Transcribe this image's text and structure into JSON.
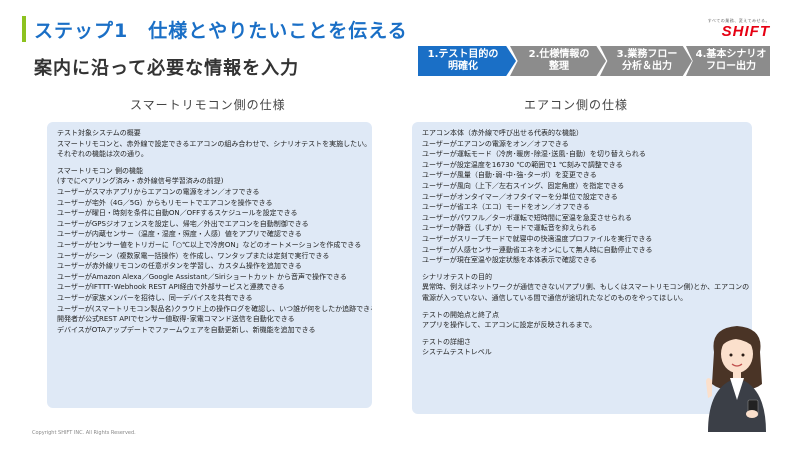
{
  "header": {
    "title": "ステップ1　仕様とやりたいことを伝える",
    "subtitle": "案内に沿って必要な情報を入力"
  },
  "logo": {
    "tagline": "すべての業務、変えてみせる。",
    "word": "SHIFT"
  },
  "steps": [
    {
      "label": "1.テスト目的の\n明確化",
      "active": true
    },
    {
      "label": "2.仕様情報の\n整理",
      "active": false
    },
    {
      "label": "3.業務フロー\n分析＆出力",
      "active": false
    },
    {
      "label": "4.基本シナリオ\nフロー出力",
      "active": false
    }
  ],
  "columns": {
    "left_header": "スマートリモコン側の仕様",
    "right_header": "エアコン側の仕様"
  },
  "left_panel": {
    "intro": [
      "テスト対象システムの概要",
      "スマートリモコンと、赤外線で設定できるエアコンの組み合わせで、シナリオテストを実施したい。",
      "それぞれの機能は次の通り。"
    ],
    "features": [
      "スマートリモコン 側の機能",
      "(すでにペアリング済み・赤外線信号学習済みの前提)",
      "ユーザーがスマホアプリからエアコンの電源をオン／オフできる",
      "ユーザーが宅外（4G／5G）からもリモートでエアコンを操作できる",
      "ユーザーが曜日・時刻を条件に自動ON／OFFするスケジュールを設定できる",
      "ユーザーがGPSジオフェンスを設定し、帰宅／外出でエアコンを自動制御できる",
      "ユーザーが内蔵センサー（温度・湿度・照度・人感）値をアプリで確認できる",
      "ユーザーがセンサー値をトリガーに「○℃以上で冷房ON」などのオートメーションを作成できる",
      "ユーザーがシーン（複数家電一括操作）を作成し、ワンタップまたは定刻で実行できる",
      "ユーザーが赤外線リモコンの任意ボタンを学習し、カスタム操作を追加できる",
      "ユーザーがAmazon Alexa／Google Assistant／Siriショートカット から音声で操作できる",
      "ユーザーがIFTTT･Webhook REST API経由で外部サービスと連携できる",
      "ユーザーが家族メンバーを招待し、同一デバイスを共有できる",
      "ユーザーが(スマートリモコン製品名)クラウド上の操作ログを確認し、いつ誰が何をしたか追跡できる",
      "開発者が公式REST APIでセンサー値取得･家電コマンド送信を自動化できる",
      "デバイスがOTAアップデートでファームウェアを自動更新し、新機能を追加できる"
    ]
  },
  "right_panel": {
    "features": [
      "エアコン本体（赤外線で呼び出せる代表的な機能）",
      "ユーザーがエアコンの電源をオン／オフできる",
      "ユーザーが運転モード（冷房･暖房･除湿･送風･自動）を切り替えられる",
      "ユーザーが設定温度を16730 ℃の範囲で1 ℃刻みで調整できる",
      "ユーザーが風量（自動･弱･中･強･ターボ）を変更できる",
      "ユーザーが風向（上下／左右スイング、固定角度）を指定できる",
      "ユーザーがオンタイマー／オフタイマーを分単位で設定できる",
      "ユーザーが省エネ（エコ）モードをオン／オフできる",
      "ユーザーがパワフル／ターボ運転で短時間に室温を急変させられる",
      "ユーザーが静音（しずか）モードで運転音を抑えられる",
      "ユーザーがスリープモードで就寝中の快適温度プロファイルを実行できる",
      "ユーザーが人感センサー連動省エネをオンにして無人時に自動停止できる",
      "ユーザーが現在室温や設定状態を本体表示で確認できる"
    ],
    "purpose": [
      "シナリオテストの目的",
      "異常時、例えばネットワークが通信できない(アプリ側、もしくはスマートリモコン側)とか、エアコンの",
      "電源が入っていない、通信している間で通信が途切れたなどのものをやってほしい。"
    ],
    "start_end": [
      "テストの開始点と終了点",
      "アプリを操作して、エアコンに設定が反映されるまで。"
    ],
    "details": [
      "テストの詳細さ",
      "システムテストレベル"
    ]
  },
  "footer": {
    "copyright": "Copyright SHIFT INC. All Rights Reserved."
  },
  "colors": {
    "accent_blue": "#1a6fc6",
    "accent_green": "#8dc21f",
    "panel_bg": "#dfe9f6",
    "step_inactive": "#8c8c8c",
    "logo_red": "#e60012"
  }
}
